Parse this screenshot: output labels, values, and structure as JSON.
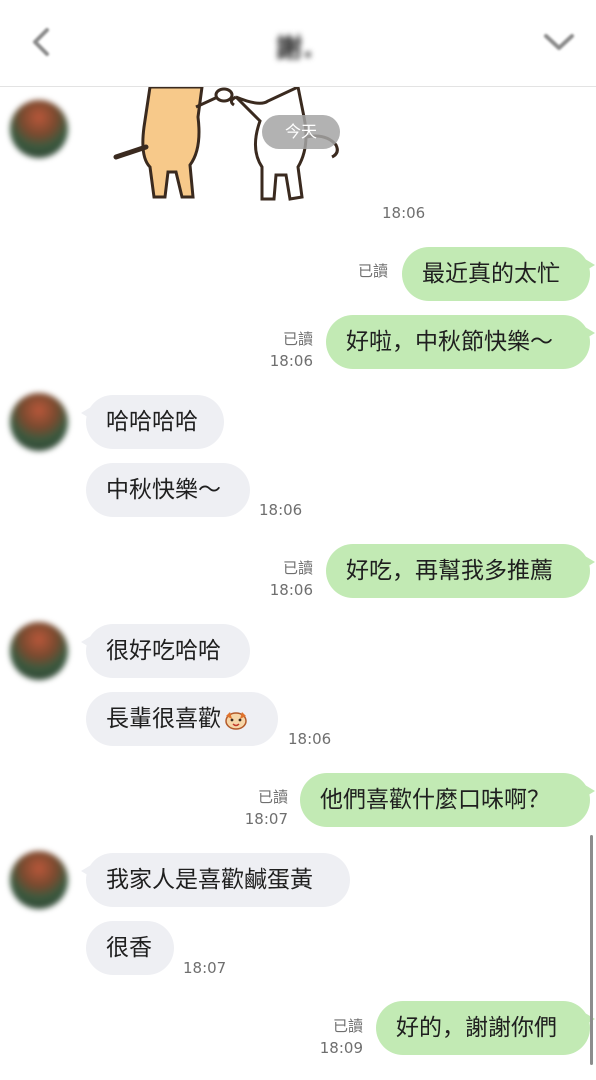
{
  "header": {
    "title": "謝.",
    "back_icon": "chevron-left-icon",
    "menu_icon": "chevron-down-icon"
  },
  "date_separator": "今天",
  "sticker_time": "18:06",
  "read_label": "已讀",
  "messages": [
    {
      "from": "me",
      "text": "最近真的太忙",
      "read": "已讀",
      "time": ""
    },
    {
      "from": "me",
      "text": "好啦，中秋節快樂～",
      "read": "已讀",
      "time": "18:06"
    },
    {
      "from": "them",
      "text": "哈哈哈哈",
      "time": ""
    },
    {
      "from": "them",
      "text": "中秋快樂～",
      "time": "18:06"
    },
    {
      "from": "me",
      "text": "好吃，再幫我多推薦",
      "read": "已讀",
      "time": "18:06"
    },
    {
      "from": "them",
      "text": "很好吃哈哈",
      "time": ""
    },
    {
      "from": "them",
      "text": "長輩很喜歡",
      "emoji": "dog-face-emoji",
      "time": "18:06"
    },
    {
      "from": "me",
      "text": "他們喜歡什麼口味啊？",
      "read": "已讀",
      "time": "18:07"
    },
    {
      "from": "them",
      "text": "我家人是喜歡鹹蛋黃",
      "time": ""
    },
    {
      "from": "them",
      "text": "很香",
      "time": "18:07"
    },
    {
      "from": "me",
      "text": "好的，謝謝你們",
      "read": "已讀",
      "time": "18:09"
    }
  ]
}
